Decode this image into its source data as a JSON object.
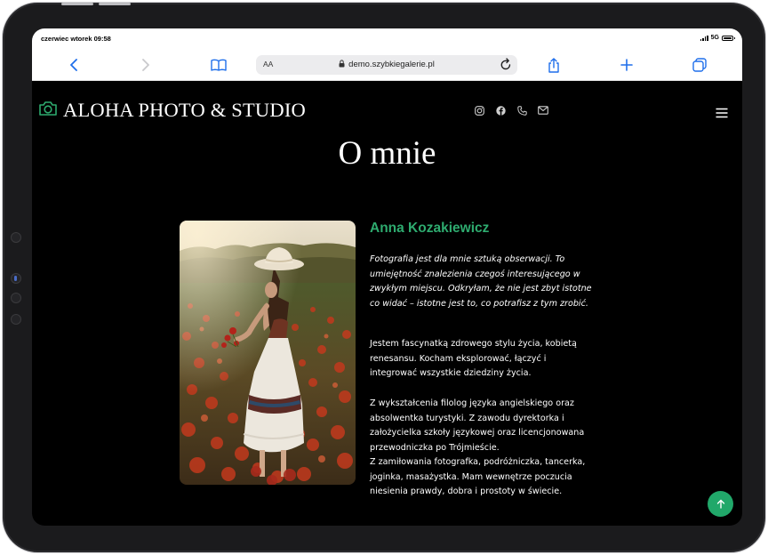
{
  "device": {
    "status_time": "czerwiec wtorek 09:58",
    "network": "5G"
  },
  "browser": {
    "text_size_label": "AA",
    "url": "demo.szybkiegalerie.pl",
    "icons": [
      "back-icon",
      "forward-icon",
      "bookmarks-icon",
      "lock-icon",
      "reload-icon",
      "share-icon",
      "new-tab-icon",
      "tabs-icon"
    ]
  },
  "site": {
    "brand": "ALOHA PHOTO & STUDIO",
    "social_icons": [
      "instagram-icon",
      "facebook-icon",
      "phone-icon",
      "mail-icon"
    ],
    "page_title": "O mnie"
  },
  "bio": {
    "name": "Anna Kozakiewicz",
    "quote_lines": [
      "Fotografia jest dla mnie sztuką obserwacji. To",
      "umiejętność znalezienia czegoś interesującego w",
      "zwykłym miejscu. Odkryłam, że nie jest zbyt istotne",
      "co widać – istotne jest to, co potrafisz z tym zrobić."
    ],
    "paragraph1_lines": [
      "Jestem fascynatką zdrowego stylu życia, kobietą",
      "renesansu. Kocham eksplorować, łączyć i",
      "integrować wszystkie dziedziny życia."
    ],
    "paragraph2_lines": [
      "Z wykształcenia filolog języka angielskiego oraz",
      "absolwentka turystyki. Z zawodu dyrektorka i",
      "założycielka szkoły językowej oraz licencjonowana",
      "przewodniczka po Trójmieście.",
      "Z zamiłowania fotografka, podróżniczka, tancerka,",
      "joginka, masażystka. Mam wewnętrze poczucia",
      "niesienia prawdy, dobra i prostoty w świecie."
    ]
  },
  "colors": {
    "accent": "#2eab6f",
    "background": "#000000",
    "fab": "#21a86a"
  }
}
